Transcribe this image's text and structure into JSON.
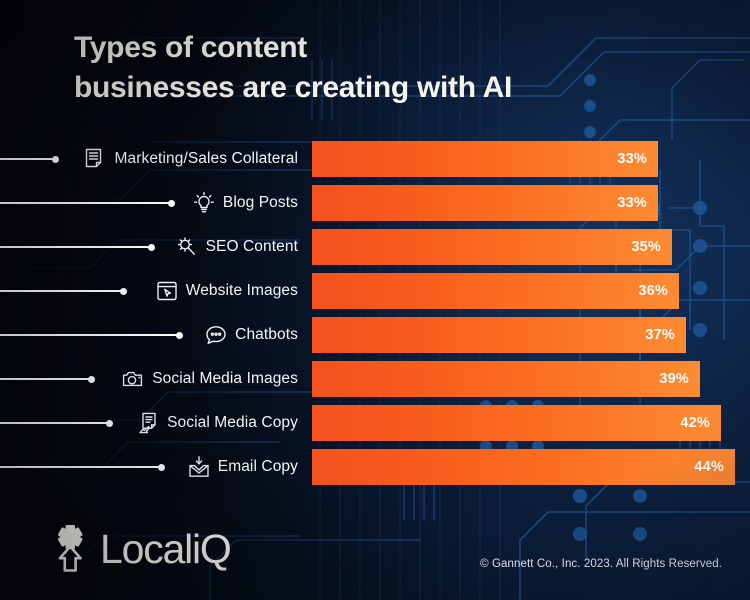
{
  "title": {
    "line1": "Types of content",
    "line2": "businesses are creating with AI"
  },
  "chart_data": {
    "type": "bar",
    "title": "Types of content businesses are creating with AI",
    "orientation": "horizontal",
    "xlabel": "",
    "ylabel": "",
    "xlim": [
      0,
      50
    ],
    "grid": false,
    "legend": false,
    "categories": [
      "Marketing/Sales Collateral",
      "Blog Posts",
      "SEO Content",
      "Website Images",
      "Chatbots",
      "Social Media Images",
      "Social Media Copy",
      "Email Copy"
    ],
    "values": [
      33,
      33,
      35,
      36,
      37,
      39,
      42,
      44
    ],
    "value_labels": [
      "33%",
      "33%",
      "35%",
      "36%",
      "37%",
      "39%",
      "42%",
      "44%"
    ],
    "icons": [
      "document-lines-icon",
      "lightbulb-icon",
      "magnifier-gear-icon",
      "browser-cursor-icon",
      "chat-bubble-icon",
      "camera-icon",
      "document-hand-icon",
      "envelope-download-icon"
    ],
    "bar_gradient": {
      "start": "#f4511e",
      "end": "#fd8b33"
    }
  },
  "rows": [
    {
      "label": "Marketing/Sales Collateral",
      "value_label": "33%",
      "value": 33,
      "icon": "document-lines-icon",
      "leader_width": 56
    },
    {
      "label": "Blog Posts",
      "value_label": "33%",
      "value": 33,
      "icon": "lightbulb-icon",
      "leader_width": 172
    },
    {
      "label": "SEO Content",
      "value_label": "35%",
      "value": 35,
      "icon": "magnifier-gear-icon",
      "leader_width": 152
    },
    {
      "label": "Website Images",
      "value_label": "36%",
      "value": 36,
      "icon": "browser-cursor-icon",
      "leader_width": 124
    },
    {
      "label": "Chatbots",
      "value_label": "37%",
      "value": 37,
      "icon": "chat-bubble-icon",
      "leader_width": 180
    },
    {
      "label": "Social Media Images",
      "value_label": "39%",
      "value": 39,
      "icon": "camera-icon",
      "leader_width": 92
    },
    {
      "label": "Social Media Copy",
      "value_label": "42%",
      "value": 42,
      "icon": "document-hand-icon",
      "leader_width": 110
    },
    {
      "label": "Email Copy",
      "value_label": "44%",
      "value": 44,
      "icon": "envelope-download-icon",
      "leader_width": 162
    }
  ],
  "footer": {
    "brand": "LocaliQ",
    "copyright": "© Gannett Co., Inc. 2023. All Rights Reserved."
  },
  "colors": {
    "background_dark": "#05070d",
    "background_blue": "#0b2142",
    "bar_start": "#f4511e",
    "bar_end": "#fd8b33",
    "text": "#f6f3ec",
    "circuit": "#1b4d8f"
  }
}
